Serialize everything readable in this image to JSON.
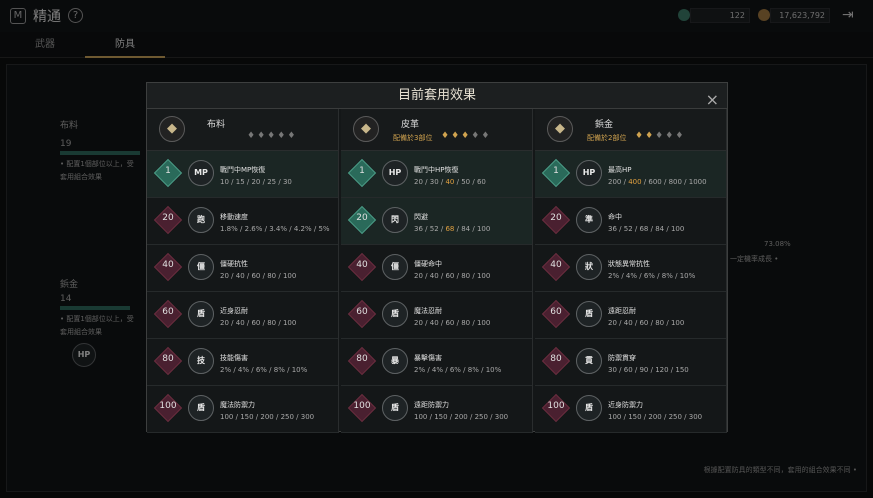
{
  "header": {
    "logo": "M",
    "title": "精通",
    "help": "?",
    "currency1": "122",
    "currency2": "17,623,792"
  },
  "tabs": [
    "武器",
    "防具"
  ],
  "background": {
    "cloth": "布料",
    "cloth_level": "19",
    "cloth_note": "• 配置1個部位以上，受",
    "combo_effect": "套用組合效果",
    "leather": "鋲金",
    "leather_level": "14",
    "leather_note": "• 配置1個部位以上，受",
    "combo2": "套用組合效果",
    "hp": "HP",
    "right_text": "73.08%",
    "right_note": "一定機率成長 •",
    "footer": "根據配置防具的類型不同，套用的組合效果不同 •"
  },
  "modal": {
    "title": "目前套用效果",
    "close": "×"
  },
  "columns": [
    {
      "name": "布料",
      "sub": "",
      "pieces_on": 0,
      "rows": [
        {
          "lvl": "1",
          "icon": "MP",
          "name": "戰鬥中MP恢復",
          "vals": [
            "10",
            "15",
            "20",
            "25",
            "30"
          ],
          "hl": -1,
          "green": true,
          "hi": true
        },
        {
          "lvl": "20",
          "icon": "跑",
          "name": "移動速度",
          "vals": [
            "1.8%",
            "2.6%",
            "3.4%",
            "4.2%",
            "5%"
          ],
          "hl": -1
        },
        {
          "lvl": "40",
          "icon": "僵",
          "name": "僵硬抗性",
          "vals": [
            "20",
            "40",
            "60",
            "80",
            "100"
          ],
          "hl": -1
        },
        {
          "lvl": "60",
          "icon": "盾",
          "name": "近身忍耐",
          "vals": [
            "20",
            "40",
            "60",
            "80",
            "100"
          ],
          "hl": -1
        },
        {
          "lvl": "80",
          "icon": "技",
          "name": "技能傷害",
          "vals": [
            "2%",
            "4%",
            "6%",
            "8%",
            "10%"
          ],
          "hl": -1
        },
        {
          "lvl": "100",
          "icon": "盾",
          "name": "魔法防禦力",
          "vals": [
            "100",
            "150",
            "200",
            "250",
            "300"
          ],
          "hl": -1
        }
      ]
    },
    {
      "name": "皮革",
      "sub": "配備於3部位",
      "pieces_on": 3,
      "rows": [
        {
          "lvl": "1",
          "icon": "HP",
          "name": "戰鬥中HP恢復",
          "vals": [
            "20",
            "30",
            "40",
            "50",
            "60"
          ],
          "hl": 2,
          "green": true,
          "hi": true
        },
        {
          "lvl": "20",
          "icon": "閃",
          "name": "閃避",
          "vals": [
            "36",
            "52",
            "68",
            "84",
            "100"
          ],
          "hl": 2,
          "green": true,
          "hi": true
        },
        {
          "lvl": "40",
          "icon": "僵",
          "name": "僵硬命中",
          "vals": [
            "20",
            "40",
            "60",
            "80",
            "100"
          ],
          "hl": -1
        },
        {
          "lvl": "60",
          "icon": "盾",
          "name": "魔法忍耐",
          "vals": [
            "20",
            "40",
            "60",
            "80",
            "100"
          ],
          "hl": -1
        },
        {
          "lvl": "80",
          "icon": "暴",
          "name": "暴擊傷害",
          "vals": [
            "2%",
            "4%",
            "6%",
            "8%",
            "10%"
          ],
          "hl": -1
        },
        {
          "lvl": "100",
          "icon": "盾",
          "name": "遠距防禦力",
          "vals": [
            "100",
            "150",
            "200",
            "250",
            "300"
          ],
          "hl": -1
        }
      ]
    },
    {
      "name": "鋲金",
      "sub": "配備於2部位",
      "pieces_on": 2,
      "rows": [
        {
          "lvl": "1",
          "icon": "HP",
          "name": "最高HP",
          "vals": [
            "200",
            "400",
            "600",
            "800",
            "1000"
          ],
          "hl": 1,
          "green": true,
          "hi": true
        },
        {
          "lvl": "20",
          "icon": "準",
          "name": "命中",
          "vals": [
            "36",
            "52",
            "68",
            "84",
            "100"
          ],
          "hl": -1
        },
        {
          "lvl": "40",
          "icon": "狀",
          "name": "狀態異常抗性",
          "vals": [
            "2%",
            "4%",
            "6%",
            "8%",
            "10%"
          ],
          "hl": -1
        },
        {
          "lvl": "60",
          "icon": "盾",
          "name": "遠距忍耐",
          "vals": [
            "20",
            "40",
            "60",
            "80",
            "100"
          ],
          "hl": -1
        },
        {
          "lvl": "80",
          "icon": "貫",
          "name": "防禦貫穿",
          "vals": [
            "30",
            "60",
            "90",
            "120",
            "150"
          ],
          "hl": -1
        },
        {
          "lvl": "100",
          "icon": "盾",
          "name": "近身防禦力",
          "vals": [
            "100",
            "150",
            "200",
            "250",
            "300"
          ],
          "hl": -1
        }
      ]
    }
  ]
}
